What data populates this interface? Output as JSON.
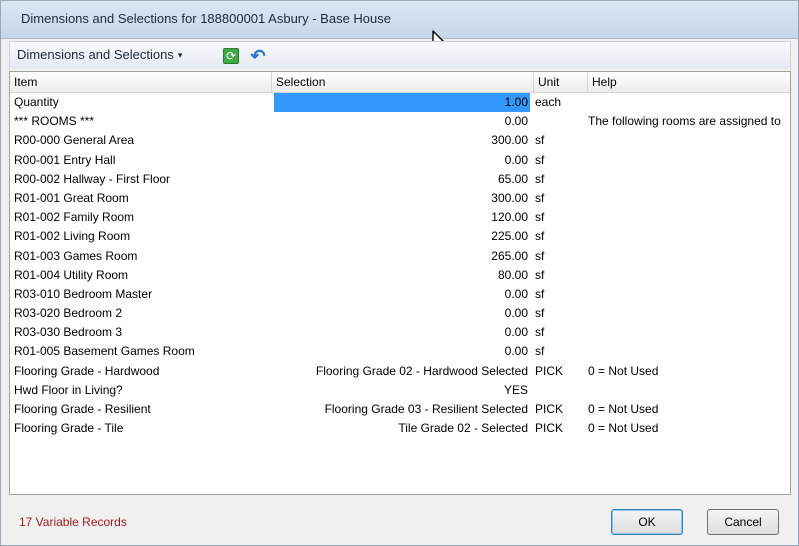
{
  "window": {
    "title": "Dimensions and Selections for 188800001  Asbury - Base House"
  },
  "toolbar": {
    "menu_label": "Dimensions and Selections",
    "caret": "▾",
    "refresh_icon": "refresh-icon",
    "undo_icon": "undo-icon"
  },
  "grid": {
    "columns": [
      "Item",
      "Selection",
      "Unit",
      "Help"
    ],
    "rows": [
      {
        "item": "Quantity",
        "selection": "1.00",
        "unit": "each",
        "help": ""
      },
      {
        "item": "*** ROOMS ***",
        "selection": "0.00",
        "unit": "",
        "help": "The following rooms are assigned to"
      },
      {
        "item": "R00-000 General Area",
        "selection": "300.00",
        "unit": "sf",
        "help": ""
      },
      {
        "item": "R00-001 Entry Hall",
        "selection": "0.00",
        "unit": "sf",
        "help": ""
      },
      {
        "item": "R00-002 Hallway - First Floor",
        "selection": "65.00",
        "unit": "sf",
        "help": ""
      },
      {
        "item": "R01-001 Great Room",
        "selection": "300.00",
        "unit": "sf",
        "help": ""
      },
      {
        "item": "R01-002 Family Room",
        "selection": "120.00",
        "unit": "sf",
        "help": ""
      },
      {
        "item": "R01-002 Living Room",
        "selection": "225.00",
        "unit": "sf",
        "help": ""
      },
      {
        "item": "R01-003 Games Room",
        "selection": "265.00",
        "unit": "sf",
        "help": ""
      },
      {
        "item": "R01-004 Utility Room",
        "selection": "80.00",
        "unit": "sf",
        "help": ""
      },
      {
        "item": "R03-010 Bedroom Master",
        "selection": "0.00",
        "unit": "sf",
        "help": ""
      },
      {
        "item": "R03-020 Bedroom 2",
        "selection": "0.00",
        "unit": "sf",
        "help": ""
      },
      {
        "item": "R03-030 Bedroom 3",
        "selection": "0.00",
        "unit": "sf",
        "help": ""
      },
      {
        "item": "R01-005 Basement Games Room",
        "selection": "0.00",
        "unit": "sf",
        "help": ""
      },
      {
        "item": "Flooring Grade - Hardwood",
        "selection": "Flooring Grade 02 - Hardwood Selected",
        "unit": "PICK",
        "help": "0 = Not Used"
      },
      {
        "item": "Hwd Floor in Living?",
        "selection": "YES",
        "unit": "",
        "help": ""
      },
      {
        "item": "Flooring Grade - Resilient",
        "selection": "Flooring Grade 03 - Resilient Selected",
        "unit": "PICK",
        "help": "0 = Not Used"
      },
      {
        "item": "Flooring Grade - Tile",
        "selection": "Tile Grade 02 -  Selected",
        "unit": "PICK",
        "help": "0 = Not Used"
      }
    ],
    "selected_row": 0
  },
  "footer": {
    "record_count": "17 Variable Records",
    "ok_label": "OK",
    "cancel_label": "Cancel"
  },
  "colors": {
    "selection_highlight": "#3399ff",
    "record_count_text": "#9b1b1b"
  }
}
